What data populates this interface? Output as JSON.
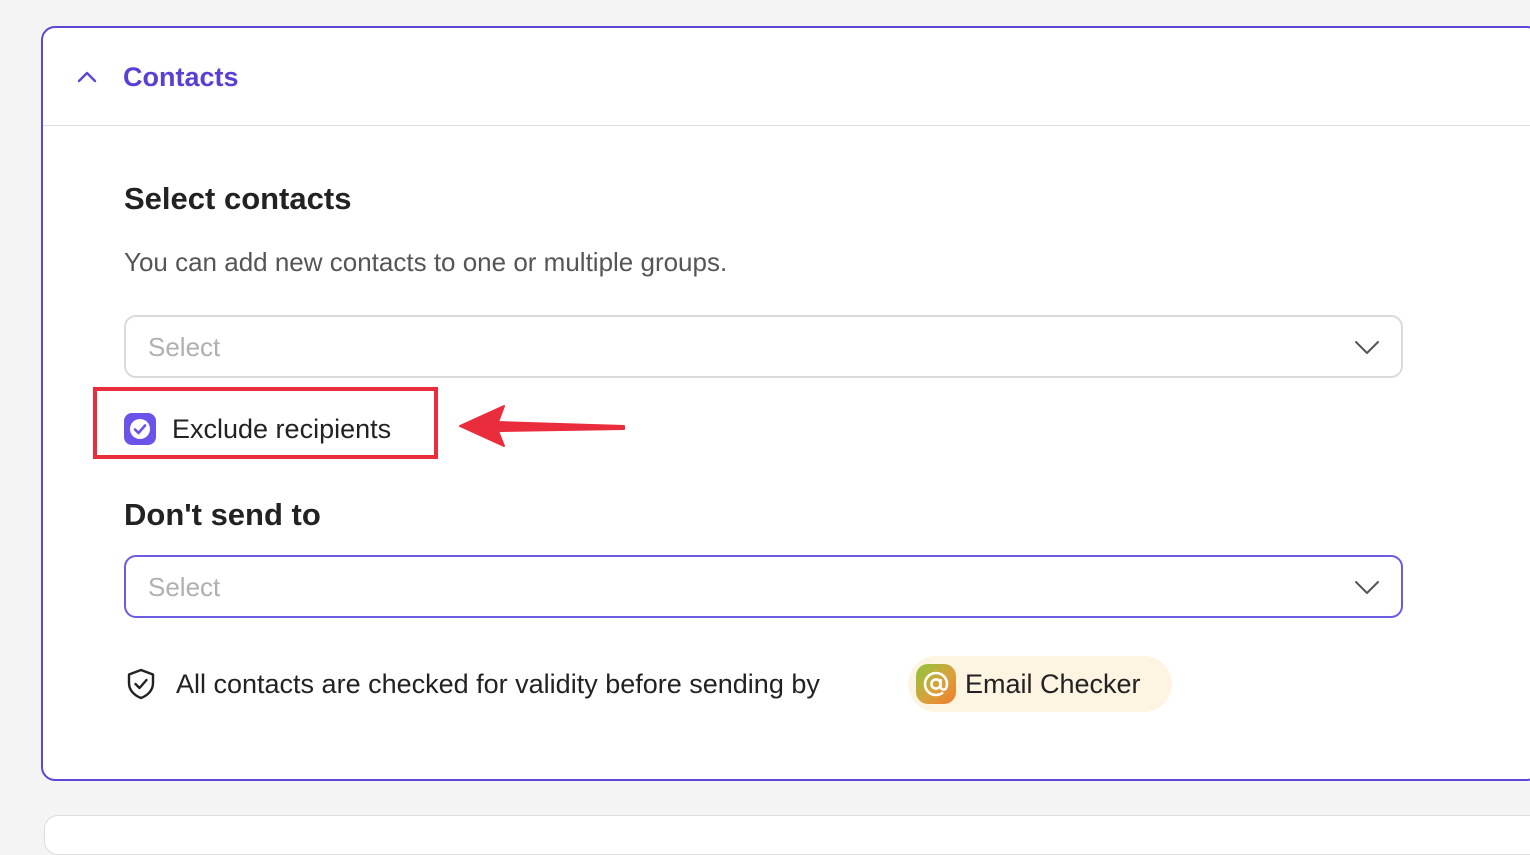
{
  "contacts_section": {
    "title": "Contacts",
    "expanded": true
  },
  "select_contacts": {
    "heading": "Select contacts",
    "description": "You can add new contacts to one or multiple groups.",
    "placeholder": "Select"
  },
  "exclude_recipients": {
    "label": "Exclude recipients",
    "checked": true
  },
  "dont_send_to": {
    "heading": "Don't send to",
    "placeholder": "Select"
  },
  "validity_notice": {
    "text": "All contacts are checked for validity before sending by",
    "badge_label": "Email Checker",
    "badge_icon": "at-sign-icon"
  },
  "annotations": {
    "highlight": "red-rectangle",
    "arrow": "red-arrow-pointing-left"
  },
  "colors": {
    "accent": "#5b47d6",
    "checkbox": "#6b52e8",
    "highlight": "#ea2d3c",
    "badge_bg": "#fdf4e1"
  }
}
